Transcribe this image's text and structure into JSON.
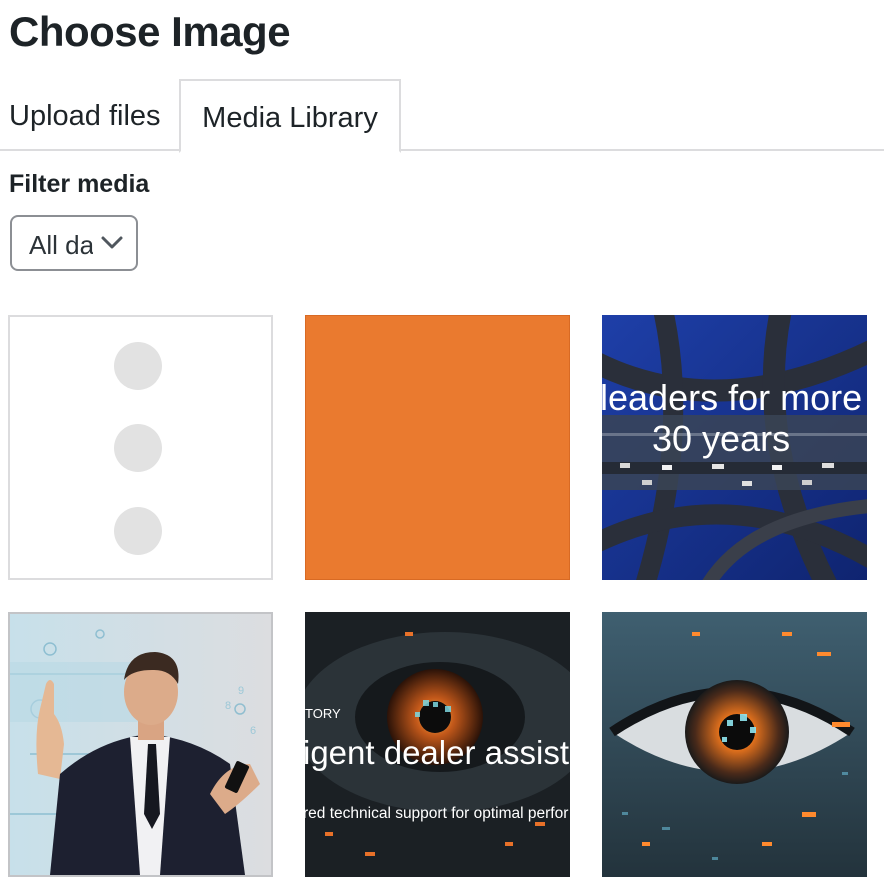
{
  "header": {
    "title": "Choose Image"
  },
  "tabs": [
    {
      "label": "Upload files",
      "active": false
    },
    {
      "label": "Media Library",
      "active": true
    }
  ],
  "filter": {
    "label": "Filter media",
    "selected": "All dates"
  },
  "media": [
    {
      "kind": "loading-placeholder"
    },
    {
      "kind": "solid-color",
      "color": "#ea7a2f"
    },
    {
      "kind": "image",
      "caption_line1": "leaders for more",
      "caption_line2": "30 years"
    },
    {
      "kind": "image",
      "subject": "businessman-with-phone"
    },
    {
      "kind": "image",
      "eyebrow": "TORY",
      "headline": "igent dealer assisto",
      "subline": "red technical support for optimal perfor"
    },
    {
      "kind": "image",
      "subject": "eye-with-circuits"
    }
  ],
  "colors": {
    "text": "#1d2327",
    "border": "#dcdcde",
    "accent_orange": "#ea7a2f"
  }
}
